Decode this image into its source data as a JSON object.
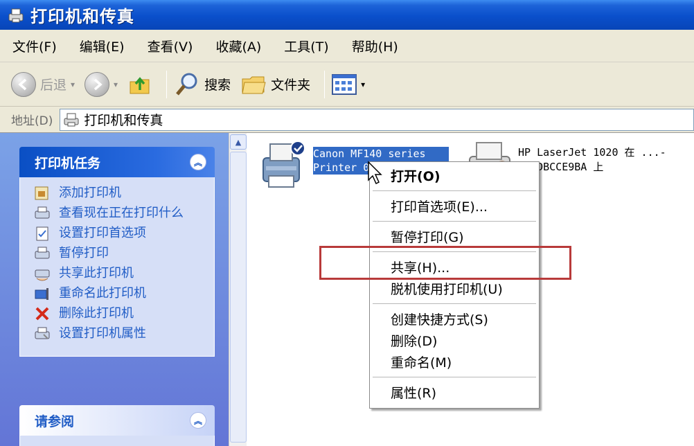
{
  "window": {
    "title": "打印机和传真"
  },
  "menu": {
    "items": [
      "文件(F)",
      "编辑(E)",
      "查看(V)",
      "收藏(A)",
      "工具(T)",
      "帮助(H)"
    ]
  },
  "toolbar": {
    "back_label": "后退",
    "search_label": "搜索",
    "folders_label": "文件夹"
  },
  "address": {
    "label": "地址(D)",
    "value": "打印机和传真"
  },
  "tasks_panel": {
    "title": "打印机任务",
    "items": [
      {
        "label": "添加打印机",
        "icon": "add-printer-icon"
      },
      {
        "label": "查看现在正在打印什么",
        "icon": "view-printing-icon"
      },
      {
        "label": "设置打印首选项",
        "icon": "preferences-icon"
      },
      {
        "label": "暂停打印",
        "icon": "pause-printer-icon"
      },
      {
        "label": "共享此打印机",
        "icon": "share-printer-icon"
      },
      {
        "label": "重命名此打印机",
        "icon": "rename-printer-icon"
      },
      {
        "label": "删除此打印机",
        "icon": "delete-icon"
      },
      {
        "label": "设置打印机属性",
        "icon": "properties-icon"
      }
    ]
  },
  "see_also_panel": {
    "title": "请参阅"
  },
  "printers": [
    {
      "label": "Canon MF140 series Printer 0",
      "selected": true,
      "default": true
    },
    {
      "label": "HP LaserJet 1020 在 ...-DA7DBCCE9BA 上",
      "selected": false,
      "default": false
    }
  ],
  "context_menu": {
    "items": [
      {
        "label": "打开(O)",
        "bold": true
      },
      {
        "separator": true
      },
      {
        "label": "打印首选项(E)..."
      },
      {
        "separator": true
      },
      {
        "label": "暂停打印(G)"
      },
      {
        "separator": true
      },
      {
        "label": "共享(H)..."
      },
      {
        "label": "脱机使用打印机(U)"
      },
      {
        "separator": true
      },
      {
        "label": "创建快捷方式(S)"
      },
      {
        "label": "删除(D)"
      },
      {
        "label": "重命名(M)"
      },
      {
        "separator": true
      },
      {
        "label": "属性(R)"
      }
    ]
  },
  "colors": {
    "titlebar": "#0a4fcb",
    "taskpane": "#6f8ae0",
    "selection": "#316ac5",
    "highlight_box": "#b83a3a"
  }
}
